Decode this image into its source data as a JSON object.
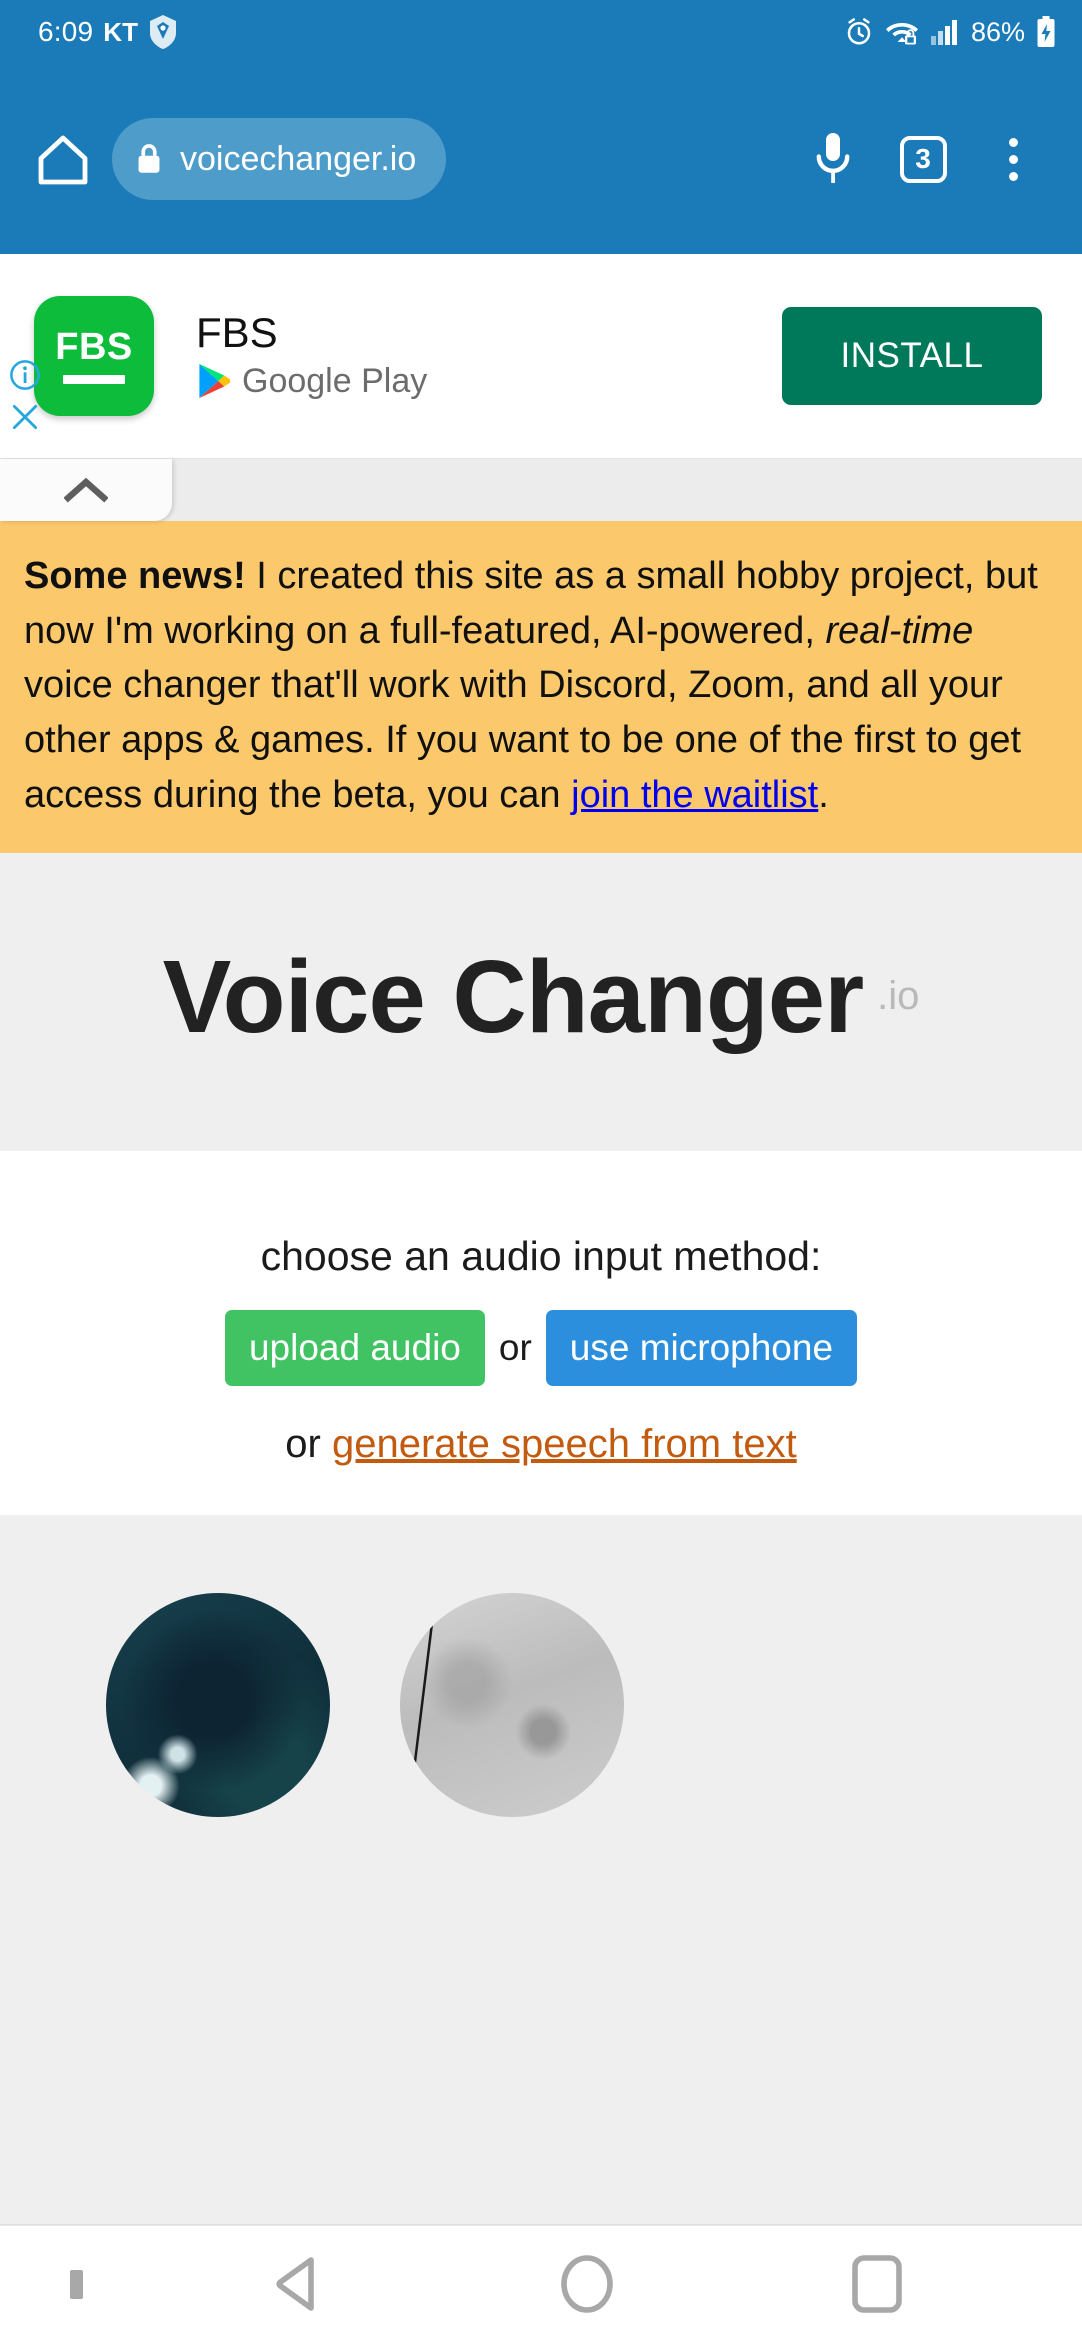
{
  "status_bar": {
    "time": "6:09",
    "carrier": "KT",
    "battery_percent": "86%",
    "icons": [
      "shield-badge-icon",
      "alarm-icon",
      "wifi-secured-icon",
      "signal-bars-icon",
      "battery-charging-icon"
    ]
  },
  "browser": {
    "home_icon": "home-icon",
    "lock_icon": "lock-icon",
    "url": "voicechanger.io",
    "mic_icon": "microphone-icon",
    "tab_count": "3",
    "menu_icon": "overflow-menu-icon"
  },
  "ad": {
    "logo_text": "FBS",
    "title": "FBS",
    "store": "Google Play",
    "store_icon": "google-play-icon",
    "install_label": "INSTALL",
    "info_icon": "ad-info-icon",
    "close_icon": "ad-close-icon",
    "install_color": "#00795B",
    "logo_color": "#0CBC3A"
  },
  "collapse": {
    "icon": "chevron-up-icon"
  },
  "news": {
    "lead": "Some news!",
    "part1": " I created this site as a small hobby project, but now I'm working on a full-featured, AI-powered, ",
    "emphasis": "real-time",
    "part2": " voice changer that'll work with Discord, Zoom, and all your other apps & games. If you want to be one of the first to get access during the beta, you can ",
    "link": "join the waitlist",
    "part3": ".",
    "background_color": "#FBC96B",
    "link_color": "#0000EE"
  },
  "hero": {
    "title": "Voice Changer",
    "tld": ".io"
  },
  "chooser": {
    "prompt": "choose an audio input method:",
    "upload_label": "upload audio",
    "or_label": "or",
    "mic_label": "use microphone",
    "sub_or": "or ",
    "sub_link": "generate speech from text",
    "upload_color": "#41C363",
    "mic_color": "#2C8FDE",
    "sub_link_color": "#C25A10"
  },
  "gallery": {
    "thumbnails": [
      {
        "name": "voice-thumbnail-1"
      },
      {
        "name": "voice-thumbnail-2"
      }
    ]
  },
  "navbar": {
    "hide_keyboard_icon": "hide-keyboard-dot-icon",
    "back_icon": "back-triangle-icon",
    "home_icon": "home-circle-icon",
    "recents_icon": "recents-square-icon"
  }
}
